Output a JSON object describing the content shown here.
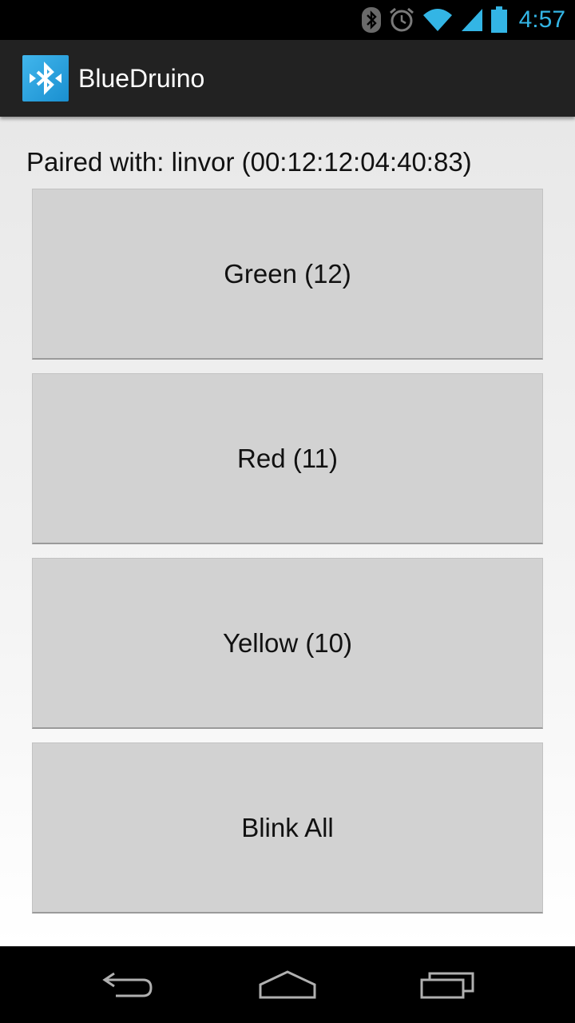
{
  "status_bar": {
    "time": "4:57",
    "icons": [
      "bluetooth-icon",
      "alarm-icon",
      "wifi-icon",
      "signal-icon",
      "battery-icon"
    ],
    "accent_color": "#33b5e5"
  },
  "action_bar": {
    "title": "BlueDruino",
    "icon": "bluetooth-app-icon"
  },
  "main": {
    "paired_text": "Paired with: linvor (00:12:12:04:40:83)",
    "buttons": [
      {
        "label": "Green (12)"
      },
      {
        "label": "Red (11)"
      },
      {
        "label": "Yellow (10)"
      },
      {
        "label": "Blink All"
      }
    ]
  },
  "nav_bar": {
    "icons": [
      "back-icon",
      "home-icon",
      "recent-apps-icon"
    ]
  }
}
